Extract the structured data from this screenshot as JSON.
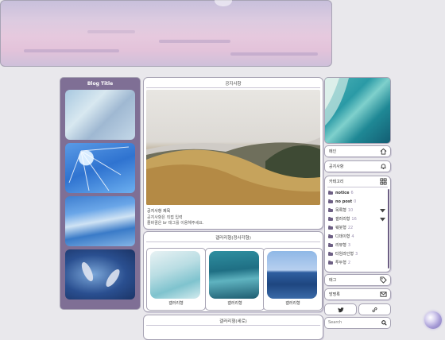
{
  "sidebar": {
    "title": "Blog Title"
  },
  "notice": {
    "header": "공지사항",
    "post_title": "공지사항 제목",
    "post_desc_line1": "공지사항은 직접 입력",
    "post_desc_line2": "줄바꿈은 br 태그를 이용해주세요."
  },
  "gallery_square": {
    "header": "갤러리형(정사각형)",
    "items": [
      {
        "label": "갤러리형"
      },
      {
        "label": "갤러리형"
      },
      {
        "label": "갤러리형"
      }
    ]
  },
  "gallery_vertical": {
    "header": "갤러리형(세로)"
  },
  "right": {
    "home": "메인",
    "notice": "공지사항",
    "category": "카테고리",
    "categories": [
      {
        "name": "notice",
        "count": "6"
      },
      {
        "name": "no post",
        "count": "0"
      },
      {
        "name": "목록형",
        "count": "10"
      },
      {
        "name": "갤러리형",
        "count": "16"
      },
      {
        "name": "웨붓형",
        "count": "22"
      },
      {
        "name": "디데이형",
        "count": "4"
      },
      {
        "name": "리뷰형",
        "count": "3"
      },
      {
        "name": "타임라인형",
        "count": "3"
      },
      {
        "name": "투두형",
        "count": "2"
      }
    ],
    "tag": "태그",
    "guestbook": "방명록",
    "search_placeholder": "Search"
  },
  "colors": {
    "accent": "#7f6f95",
    "border": "#a7a3b4",
    "background": "#e9e8ec"
  },
  "icons": [
    "home-icon",
    "bell-icon",
    "category-icon",
    "tag-icon",
    "mail-icon",
    "twitter-icon",
    "link-icon",
    "search-icon",
    "folder-icon",
    "caret-down-icon"
  ]
}
